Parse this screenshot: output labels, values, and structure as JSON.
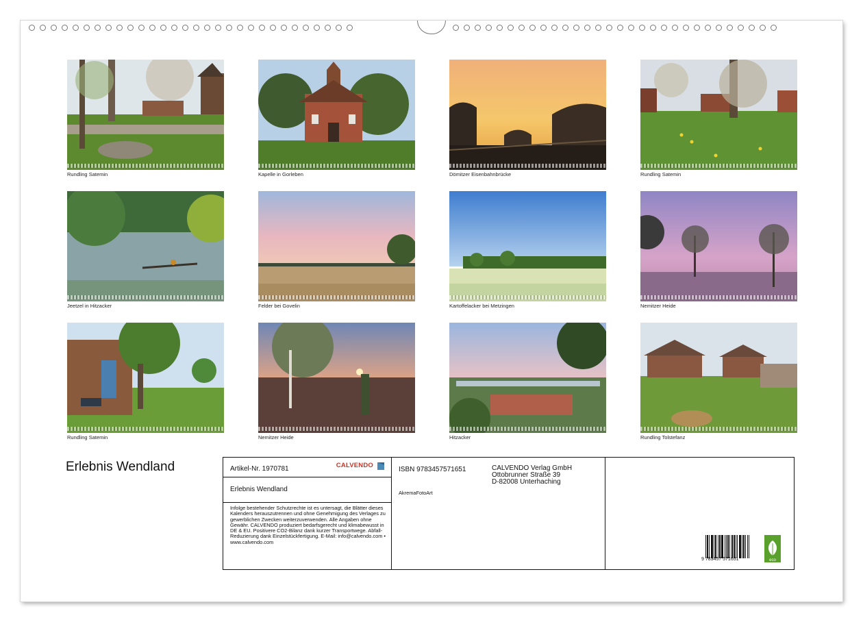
{
  "calendar": {
    "title": "Erlebnis Wendland",
    "photos": [
      {
        "caption": "Rundling Satemin"
      },
      {
        "caption": "Kapelle in Gorleben"
      },
      {
        "caption": "Dömitzer Eisenbahnbrücke"
      },
      {
        "caption": "Rundling Satemin"
      },
      {
        "caption": "Jeetzel in Hitzacker"
      },
      {
        "caption": "Felder bei Govelin"
      },
      {
        "caption": "Kartoffelacker bei Metzingen"
      },
      {
        "caption": "Nemitzer Heide"
      },
      {
        "caption": "Rundling Satemin"
      },
      {
        "caption": "Nemitzer Heide"
      },
      {
        "caption": "Hitzacker"
      },
      {
        "caption": "Rundling Tolstefanz"
      }
    ]
  },
  "info": {
    "article": "Artikel-Nr. 1970781",
    "brand": "CALVENDO",
    "title": "Erlebnis Wendland",
    "legal": "Infolge bestehender Schutzrechte ist es untersagt, die Blätter dieses Kalenders herauszutrennen und ohne Genehmigung des Verlages zu gewerblichen Zwecken weiterzuverwenden. Alle Angaben ohne Gewähr. CALVENDO produziert bedarfsgerecht und klimabewusst in DE & EU. Positivere CO2-Bilanz dank kurzer Transportwege. Abfall-Reduzierung dank Einzelstückfertigung. E-Mail: info@calvendo.com • www.calvendo.com",
    "isbn": "ISBN 9783457571651",
    "author": "AkremaFotoArt",
    "publisher": [
      "CALVENDO Verlag GmbH",
      "Ottobrunner Straße 39",
      "D-82008 Unterhaching"
    ],
    "barcode_digits": "9 783457 571651",
    "eco_label": "eco"
  }
}
